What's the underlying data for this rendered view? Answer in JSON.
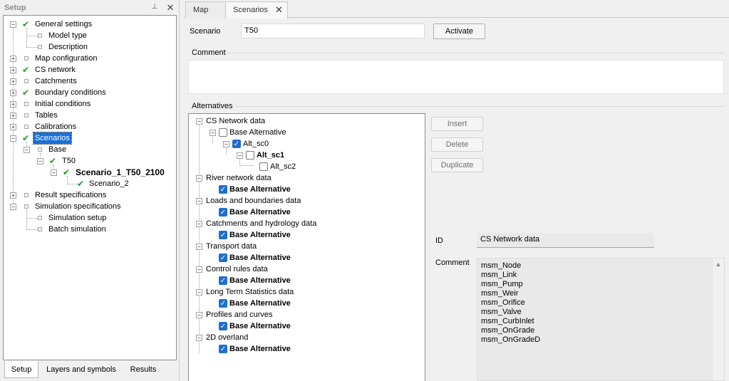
{
  "setup_panel": {
    "title": "Setup",
    "pin_glyph": "⊥",
    "close_glyph": "✕",
    "tree": [
      {
        "label": "General settings",
        "checked": true
      },
      {
        "label": "Model type"
      },
      {
        "label": "Description"
      },
      {
        "label": "Map configuration"
      },
      {
        "label": "CS network",
        "checked": true
      },
      {
        "label": "Catchments"
      },
      {
        "label": "Boundary conditions",
        "checked": true
      },
      {
        "label": "Initial conditions"
      },
      {
        "label": "Tables"
      },
      {
        "label": "Calibrations"
      },
      {
        "label": "Scenarios",
        "checked": true,
        "selected": true
      },
      {
        "label": "Base"
      },
      {
        "label": "T50",
        "checked": true
      },
      {
        "label": "Scenario_1_T50_2100",
        "checked": true,
        "bold": true
      },
      {
        "label": "Scenario_2",
        "checked": true
      },
      {
        "label": "Result specifications"
      },
      {
        "label": "Simulation specifications"
      },
      {
        "label": "Simulation setup"
      },
      {
        "label": "Batch simulation"
      }
    ],
    "bottom_tabs": [
      "Setup",
      "Layers and symbols",
      "Results"
    ],
    "active_bottom_tab": "Setup"
  },
  "doc_tabs": {
    "tabs": [
      "Map",
      "Scenarios"
    ],
    "active": "Scenarios",
    "close_glyph": "✕"
  },
  "scenario": {
    "label": "Scenario",
    "value": "T50",
    "activate_label": "Activate"
  },
  "comment_group": {
    "label": "Comment",
    "value": ""
  },
  "alternatives": {
    "label": "Alternatives",
    "groups": [
      {
        "name": "CS Network data"
      },
      {
        "name": "Base Alternative",
        "checked": false
      },
      {
        "name": "Alt_sc0",
        "checked": true
      },
      {
        "name": "Alt_sc1",
        "checked": false,
        "bold": true
      },
      {
        "name": "Alt_sc2",
        "checked": false
      },
      {
        "name": "River network data"
      },
      {
        "name": "Base Alternative",
        "checked": true,
        "bold": true
      },
      {
        "name": "Loads and boundaries data"
      },
      {
        "name": "Base Alternative",
        "checked": true,
        "bold": true
      },
      {
        "name": "Catchments and hydrology data"
      },
      {
        "name": "Base Alternative",
        "checked": true,
        "bold": true
      },
      {
        "name": "Transport data"
      },
      {
        "name": "Base Alternative",
        "checked": true,
        "bold": true
      },
      {
        "name": "Control rules data"
      },
      {
        "name": "Base Alternative",
        "checked": true,
        "bold": true
      },
      {
        "name": "Long Term Statistics data"
      },
      {
        "name": "Base Alternative",
        "checked": true,
        "bold": true
      },
      {
        "name": "Profiles and curves"
      },
      {
        "name": "Base Alternative",
        "checked": true,
        "bold": true
      },
      {
        "name": "2D overland"
      },
      {
        "name": "Base Alternative",
        "checked": true,
        "bold": true
      }
    ],
    "buttons": {
      "insert": "Insert",
      "delete": "Delete",
      "duplicate": "Duplicate"
    }
  },
  "details": {
    "id_label": "ID",
    "id_value": "CS Network data",
    "comment_label": "Comment",
    "comment_lines": [
      "msm_Node",
      "msm_Link",
      "msm_Pump",
      "msm_Weir",
      "msm_Orifice",
      "msm_Valve",
      "msm_CurbInlet",
      "msm_OnGrade",
      "msm_OnGradeD"
    ]
  },
  "colors": {
    "check_green": "#1f9a1f",
    "selection_blue": "#1c6fd6",
    "checkbox_blue": "#1f6fd0"
  }
}
